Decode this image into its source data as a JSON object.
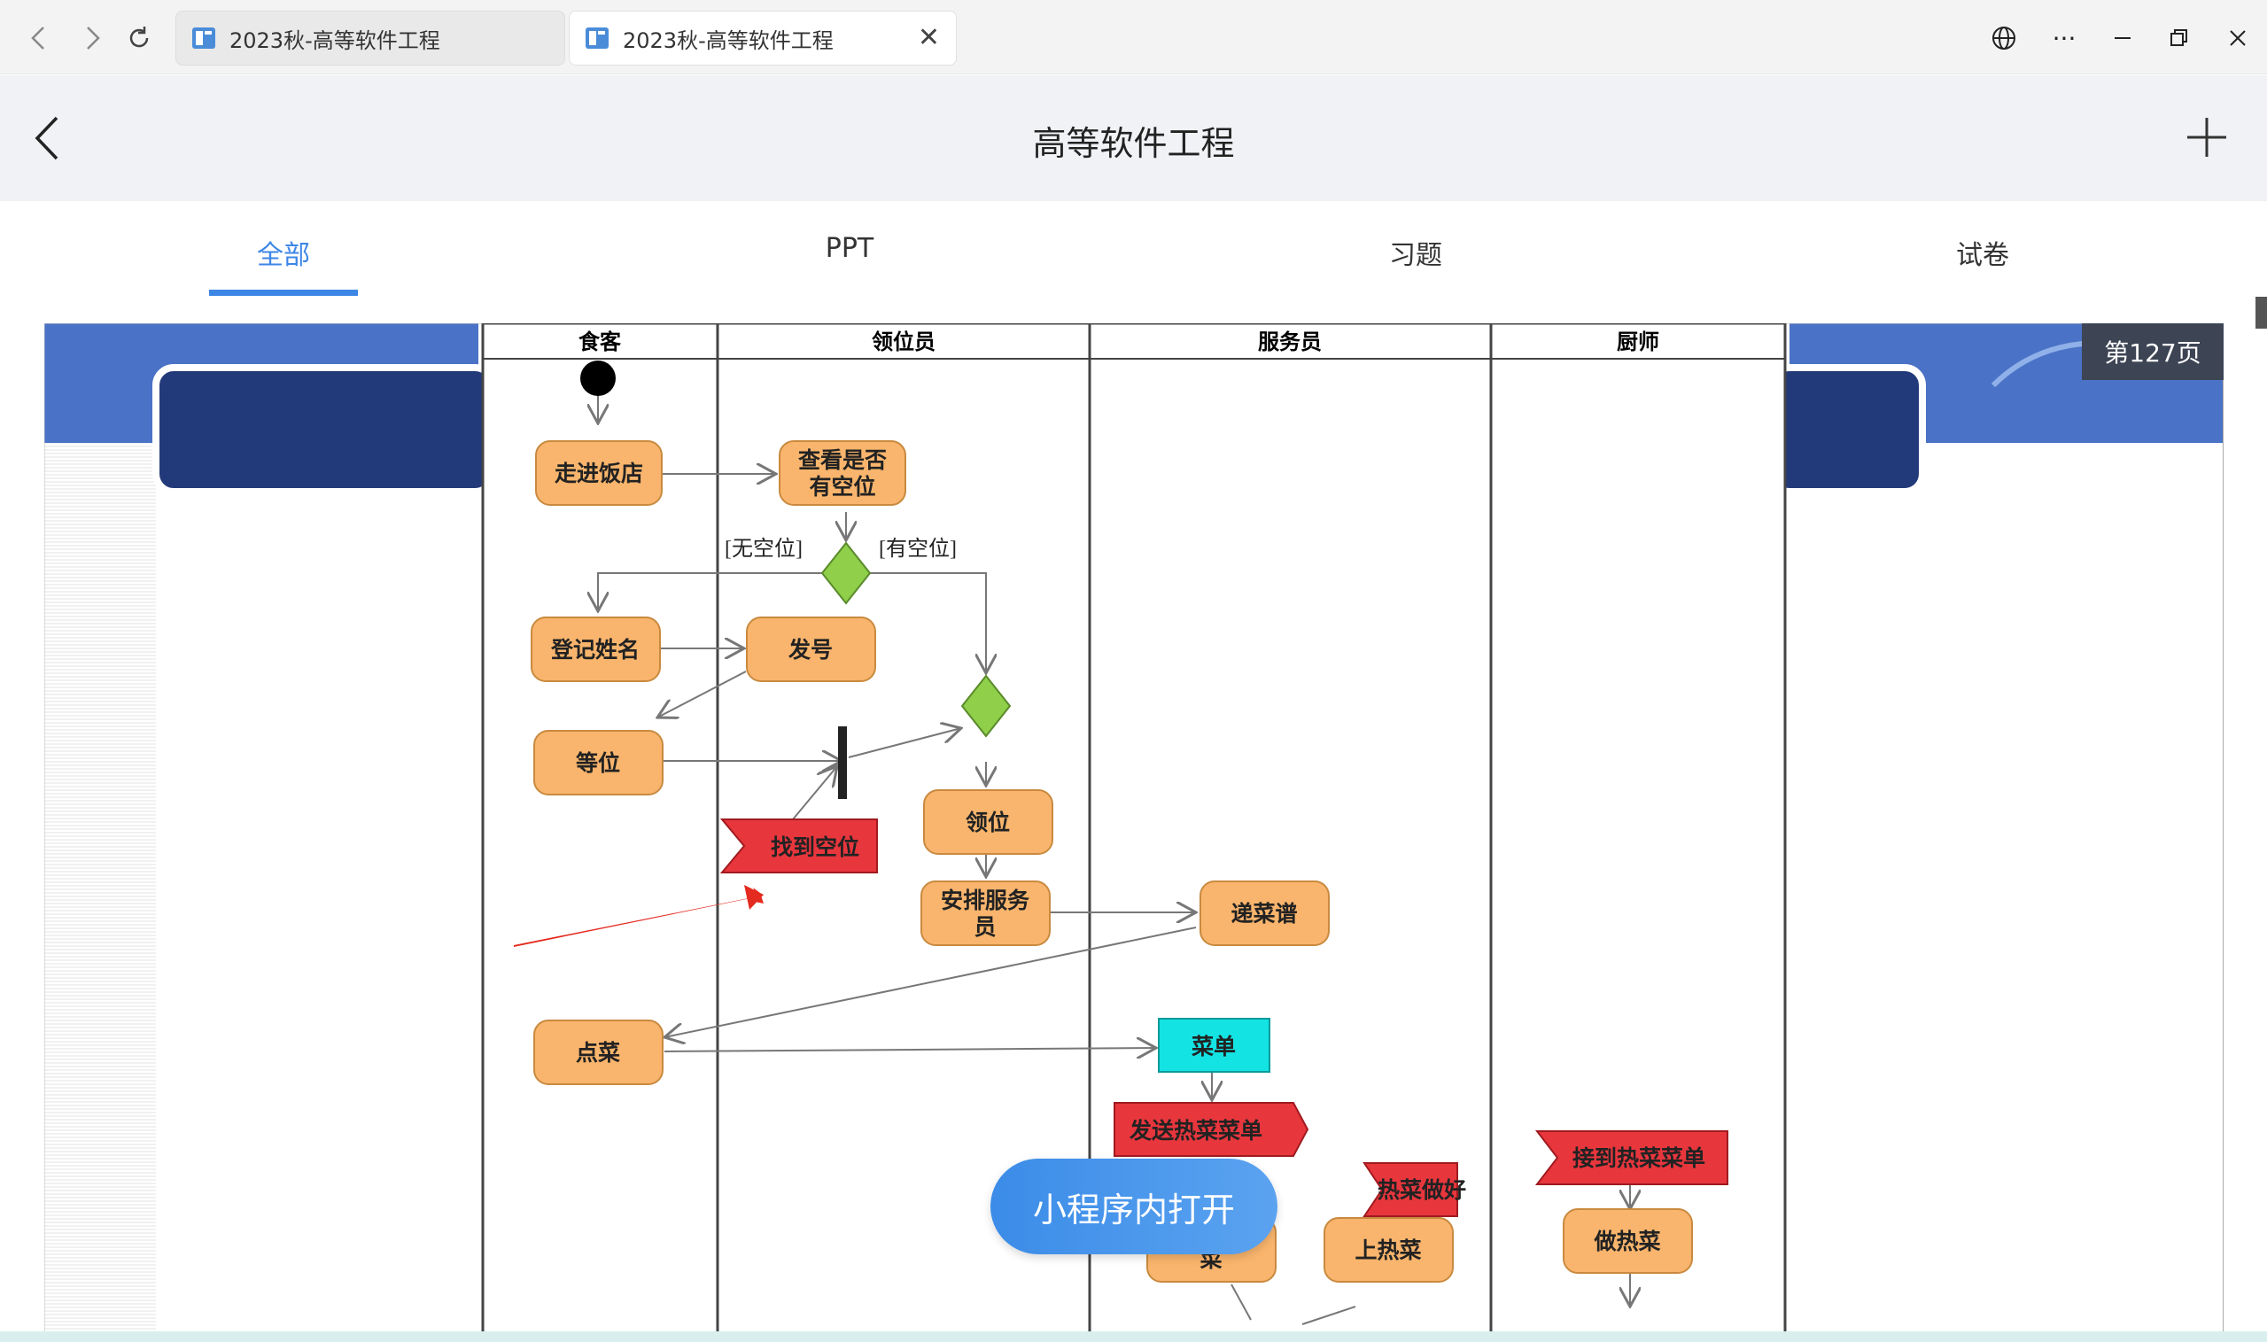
{
  "browser": {
    "tabs": [
      {
        "title": "2023秋-高等软件工程",
        "active": false
      },
      {
        "title": "2023秋-高等软件工程",
        "active": true
      }
    ],
    "icons": {
      "back": "back-arrow-icon",
      "forward": "forward-arrow-icon",
      "refresh": "refresh-icon",
      "globe": "globe-icon",
      "more": "more-icon",
      "minimize": "minimize-icon",
      "restore": "restore-icon",
      "close": "close-icon"
    }
  },
  "header": {
    "title": "高等软件工程"
  },
  "tabs": [
    {
      "label": "全部",
      "active": true
    },
    {
      "label": "PPT",
      "active": false
    },
    {
      "label": "习题",
      "active": false
    },
    {
      "label": "试卷",
      "active": false
    }
  ],
  "page_badge": "第127页",
  "miniapp_button": "小程序内打开",
  "diagram": {
    "lanes": [
      "食客",
      "领位员",
      "服务员",
      "厨师"
    ],
    "nodes": {
      "walk_in": "走进饭店",
      "check_seat_l1": "查看是否",
      "check_seat_l2": "有空位",
      "register": "登记姓名",
      "issue_number": "发号",
      "wait": "等位",
      "found_seat": "找到空位",
      "lead_seat": "领位",
      "arrange_l1": "安排服务",
      "arrange_l2": "员",
      "pass_menu": "递菜谱",
      "order": "点菜",
      "menu": "菜单",
      "send_hot": "发送热菜菜单",
      "hot_done": "热菜做好",
      "serve_hot": "上热菜",
      "receive_hot": "接到热菜菜单",
      "cook_hot": "做热菜",
      "hidden_partial": "菜"
    },
    "guards": {
      "no_seat": "[无空位]",
      "has_seat": "[有空位]"
    }
  },
  "colors": {
    "accent": "#3d86e6",
    "node_fill": "#f9b56d",
    "signal_red": "#e8363d",
    "decision_green": "#8fcf4a",
    "menu_cyan": "#14e3e3",
    "slide_navy": "#233a7a",
    "slide_blue": "#4a72c6"
  }
}
